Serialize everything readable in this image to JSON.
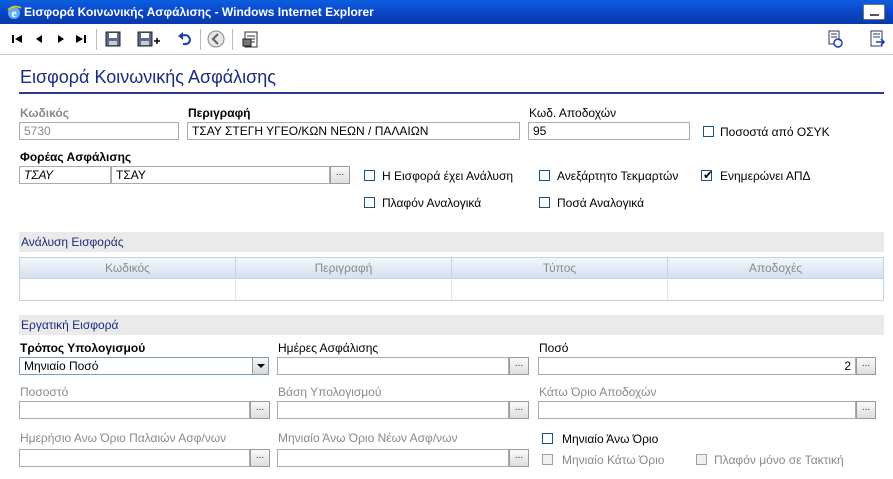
{
  "window": {
    "title": "Εισφορά Κοινωνικής Ασφάλισης - Windows Internet Explorer"
  },
  "icons": {
    "first": "first-record-icon",
    "prev": "prev-record-icon",
    "next": "next-record-icon",
    "last": "last-record-icon",
    "save": "save-icon",
    "save_new": "save-new-icon",
    "undo": "undo-icon",
    "back": "back-icon",
    "report": "report-icon",
    "tool1": "refresh-doc-icon",
    "tool2": "export-doc-icon"
  },
  "form": {
    "title": "Εισφορά Κοινωνικής Ασφάλισης",
    "code": {
      "label": "Κωδικός",
      "value": "5730"
    },
    "description": {
      "label": "Περιγραφή",
      "value": "ΤΣΑΥ ΣΤΕΓΗ ΥΓΕΟ/ΚΩΝ ΝΕΩΝ / ΠΑΛΑΙΩΝ"
    },
    "pay_code": {
      "label": "Κωδ. Αποδοχών",
      "value": "95"
    },
    "osyk_pct": {
      "label": "Ποσοστά από ΟΣΥΚ",
      "checked": false
    },
    "fund": {
      "label": "Φορέας Ασφάλισης",
      "code": "ΤΣΑΥ",
      "name": "ΤΣΑΥ",
      "browse": "..."
    },
    "has_analysis": {
      "label": "Η Εισφορά έχει Ανάλυση",
      "checked": false
    },
    "independent": {
      "label": "Ανεξάρτητο Τεκμαρτών",
      "checked": false
    },
    "updates_apd": {
      "label": "Ενημερώνει ΑΠΔ",
      "checked": true,
      "mark": "✔"
    },
    "ceiling_prop": {
      "label": "Πλαφόν Αναλογικά",
      "checked": false
    },
    "amounts_prop": {
      "label": "Ποσά Αναλογικά",
      "checked": false
    }
  },
  "analysis": {
    "section_title": "Ανάλυση Εισφοράς",
    "columns": [
      "Κωδικός",
      "Περιγραφή",
      "Τύπος",
      "Αποδοχές"
    ]
  },
  "employee": {
    "section_title": "Εργατική Εισφορά",
    "calc_method": {
      "label": "Τρόπος Υπολογισμού",
      "value": "Μηνιαίο Ποσό"
    },
    "insurance_days": {
      "label": "Ημέρες Ασφάλισης",
      "value": "",
      "browse": "..."
    },
    "amount": {
      "label": "Ποσό",
      "value": "2",
      "browse": "..."
    },
    "percent": {
      "label": "Ποσοστό",
      "value": "",
      "browse": "..."
    },
    "calc_base": {
      "label": "Βάση Υπολογισμού",
      "value": "",
      "browse": "..."
    },
    "lower_pay_limit": {
      "label": "Κάτω Όριο Αποδοχών",
      "value": "",
      "browse": "..."
    },
    "daily_upper_old": {
      "label": "Ημερήσιο Ανω Όριο Παλαιών Ασφ/νων",
      "value": "",
      "browse": "..."
    },
    "monthly_upper_new": {
      "label": "Μηνιαίο Άνω Όριο Νέων Ασφ/νων",
      "value": "",
      "browse": "..."
    },
    "monthly_upper": {
      "label": "Μηνιαίο Άνω Όριο",
      "checked": false
    },
    "monthly_lower": {
      "label": "Μηνιαίο Κάτω Όριο",
      "checked": false
    },
    "ceiling_regular_only": {
      "label": "Πλαφόν μόνο σε Τακτική",
      "checked": false
    }
  }
}
